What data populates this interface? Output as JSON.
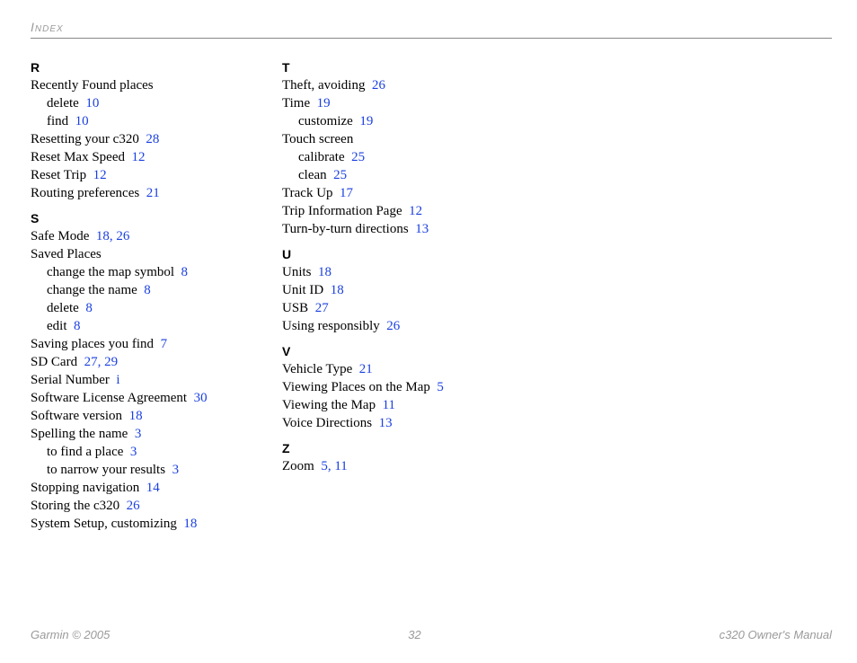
{
  "header": "Index",
  "sections": [
    {
      "letter": "R",
      "entries": [
        {
          "text": "Recently Found places",
          "pages": "",
          "sub": false
        },
        {
          "text": "delete",
          "pages": "10",
          "sub": true
        },
        {
          "text": "find",
          "pages": "10",
          "sub": true
        },
        {
          "text": "Resetting your c320",
          "pages": "28",
          "sub": false
        },
        {
          "text": "Reset Max Speed",
          "pages": "12",
          "sub": false
        },
        {
          "text": "Reset Trip",
          "pages": "12",
          "sub": false
        },
        {
          "text": "Routing preferences",
          "pages": "21",
          "sub": false
        }
      ]
    },
    {
      "letter": "S",
      "entries": [
        {
          "text": "Safe Mode",
          "pages": "18, 26",
          "sub": false
        },
        {
          "text": "Saved Places",
          "pages": "",
          "sub": false
        },
        {
          "text": "change the map symbol",
          "pages": "8",
          "sub": true
        },
        {
          "text": "change the name",
          "pages": "8",
          "sub": true
        },
        {
          "text": "delete",
          "pages": "8",
          "sub": true
        },
        {
          "text": "edit",
          "pages": "8",
          "sub": true
        },
        {
          "text": "Saving places you find",
          "pages": "7",
          "sub": false
        },
        {
          "text": "SD Card",
          "pages": "27, 29",
          "sub": false
        },
        {
          "text": "Serial Number",
          "pages": "i",
          "sub": false
        },
        {
          "text": "Software License Agreement",
          "pages": "30",
          "sub": false
        },
        {
          "text": "Software version",
          "pages": "18",
          "sub": false
        },
        {
          "text": "Spelling the name",
          "pages": "3",
          "sub": false
        },
        {
          "text": "to find a place",
          "pages": "3",
          "sub": true
        },
        {
          "text": "to narrow your results",
          "pages": "3",
          "sub": true
        },
        {
          "text": "Stopping navigation",
          "pages": "14",
          "sub": false
        },
        {
          "text": "Storing the c320",
          "pages": "26",
          "sub": false
        },
        {
          "text": "System Setup, customizing",
          "pages": "18",
          "sub": false
        }
      ]
    },
    {
      "letter": "T",
      "entries": [
        {
          "text": "Theft, avoiding",
          "pages": "26",
          "sub": false
        },
        {
          "text": "Time",
          "pages": "19",
          "sub": false
        },
        {
          "text": "customize",
          "pages": "19",
          "sub": true
        },
        {
          "text": "Touch screen",
          "pages": "",
          "sub": false
        },
        {
          "text": "calibrate",
          "pages": "25",
          "sub": true
        },
        {
          "text": "clean",
          "pages": "25",
          "sub": true
        },
        {
          "text": "Track Up",
          "pages": "17",
          "sub": false
        },
        {
          "text": "Trip Information Page",
          "pages": "12",
          "sub": false
        },
        {
          "text": "Turn-by-turn directions",
          "pages": "13",
          "sub": false
        }
      ]
    },
    {
      "letter": "U",
      "entries": [
        {
          "text": "Units",
          "pages": "18",
          "sub": false
        },
        {
          "text": "Unit ID",
          "pages": "18",
          "sub": false
        },
        {
          "text": "USB",
          "pages": "27",
          "sub": false
        },
        {
          "text": "Using responsibly",
          "pages": "26",
          "sub": false
        }
      ]
    },
    {
      "letter": "V",
      "entries": [
        {
          "text": "Vehicle Type",
          "pages": "21",
          "sub": false
        },
        {
          "text": "Viewing Places on the Map",
          "pages": "5",
          "sub": false
        },
        {
          "text": "Viewing the Map",
          "pages": "11",
          "sub": false
        },
        {
          "text": "Voice Directions",
          "pages": "13",
          "sub": false
        }
      ]
    },
    {
      "letter": "Z",
      "entries": [
        {
          "text": "Zoom",
          "pages": "5, 11",
          "sub": false
        }
      ]
    }
  ],
  "footer": {
    "left": "Garmin © 2005",
    "center": "32",
    "right": "c320 Owner's Manual"
  },
  "layout": {
    "column_break_before_section": 2
  }
}
